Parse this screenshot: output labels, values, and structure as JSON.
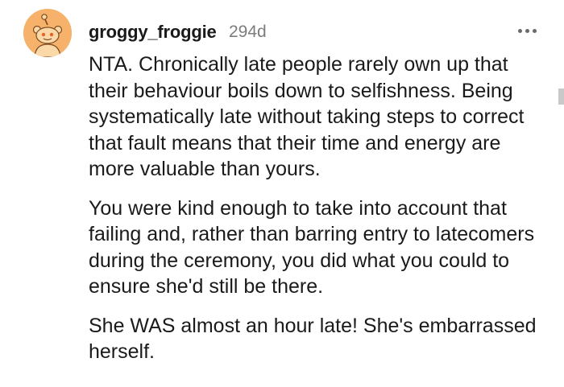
{
  "comment": {
    "username": "groggy_froggie",
    "timestamp": "294d",
    "more_icon": "more-horizontal-icon",
    "avatar_icon": "reddit-snoo-avatar-icon",
    "avatar_color": "#f6b26b",
    "paragraphs": [
      "NTA. Chronically late people rarely own up that their behaviour boils down to selfishness. Being systematically late without taking steps to correct that fault means that their time and energy are more valuable than yours.",
      "You were kind enough to take into account that failing and, rather than barring entry to latecomers during the ceremony, you did what you could to ensure she'd still be there.",
      "She WAS almost an hour late! She's embarrassed herself."
    ]
  }
}
